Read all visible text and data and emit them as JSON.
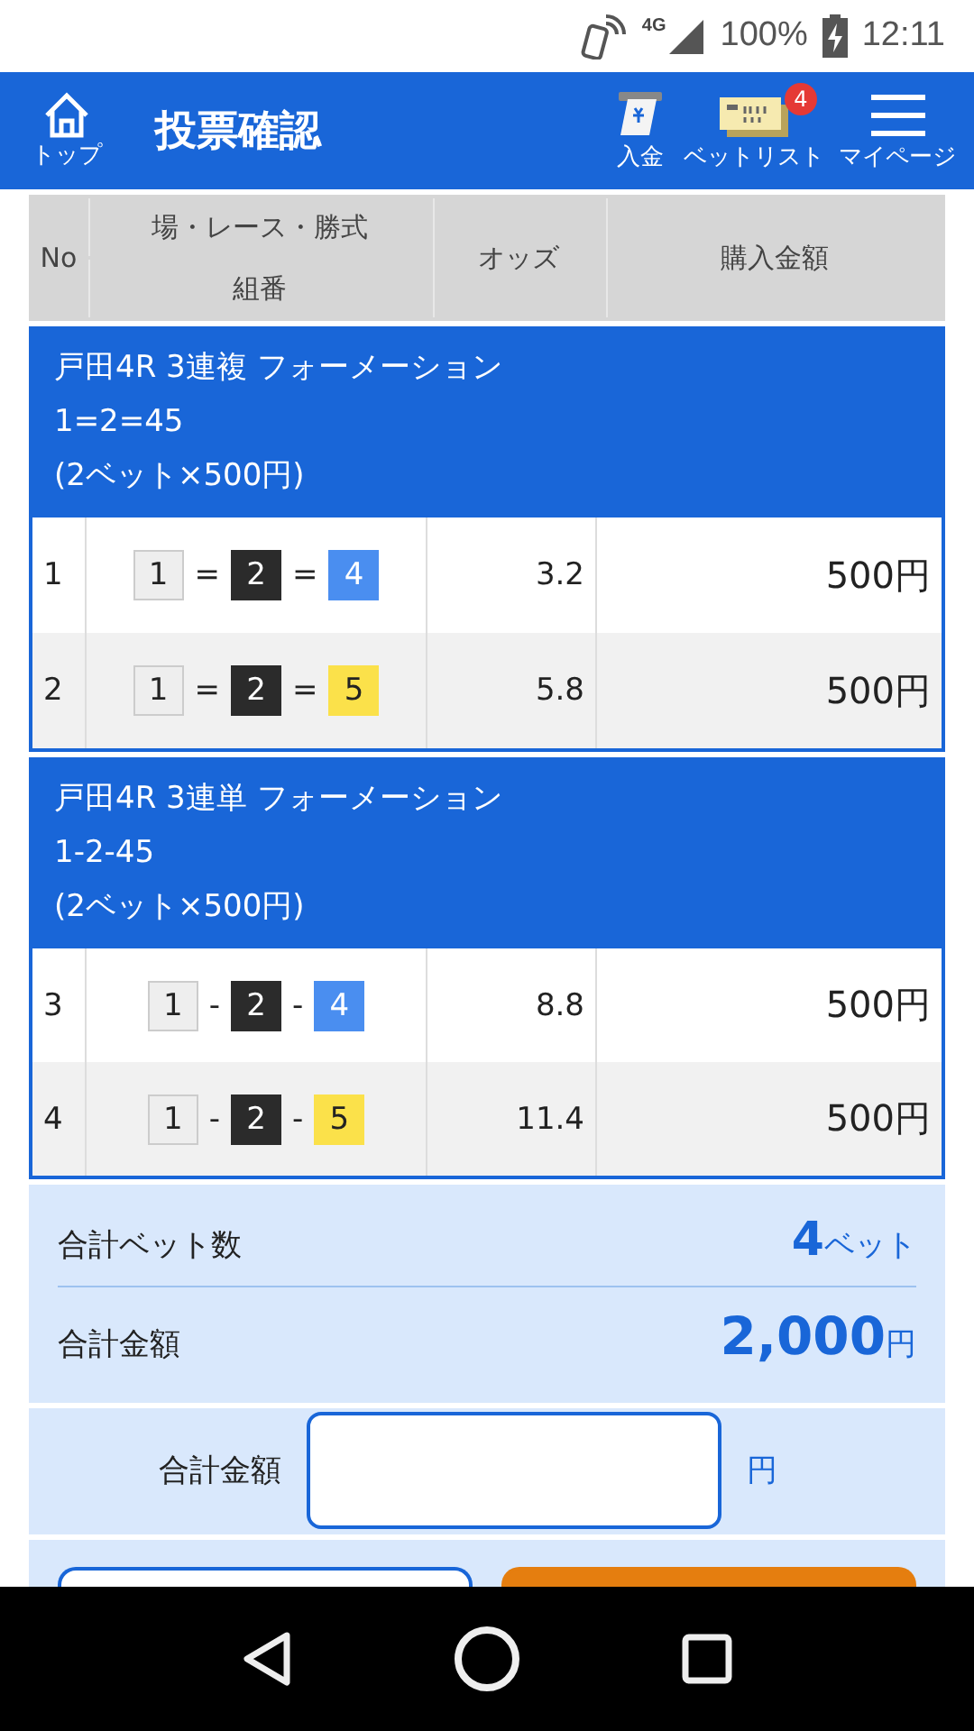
{
  "status_bar": {
    "network": "4G",
    "battery": "100%",
    "time": "12:11"
  },
  "header": {
    "home_label": "トップ",
    "title": "投票確認",
    "actions": [
      {
        "label": "入金",
        "kind": "deposit"
      },
      {
        "label": "ベットリスト",
        "kind": "betlist",
        "badge": "4"
      },
      {
        "label": "マイページ",
        "kind": "menu"
      }
    ]
  },
  "table": {
    "columns": {
      "no": "No",
      "race_top": "場・レース・勝式",
      "race_bottom": "組番",
      "odds": "オッズ",
      "amount": "購入金額"
    },
    "groups": [
      {
        "title": "戸田4R 3連複 フォーメーション",
        "combination": "1=2=45",
        "detail": "(2ベット×500円)",
        "rows": [
          {
            "no": "1",
            "combo": [
              {
                "kind": "boat",
                "label": "1",
                "color": "#eeeeee"
              },
              {
                "kind": "sep",
                "label": "="
              },
              {
                "kind": "boat",
                "label": "2",
                "color": "#2b2b2b"
              },
              {
                "kind": "sep",
                "label": "="
              },
              {
                "kind": "boat",
                "label": "4",
                "color": "#4a8ef0"
              }
            ],
            "odds": "3.2",
            "amount": "500円"
          },
          {
            "no": "2",
            "combo": [
              {
                "kind": "boat",
                "label": "1",
                "color": "#eeeeee"
              },
              {
                "kind": "sep",
                "label": "="
              },
              {
                "kind": "boat",
                "label": "2",
                "color": "#2b2b2b"
              },
              {
                "kind": "sep",
                "label": "="
              },
              {
                "kind": "boat",
                "label": "5",
                "color": "#fbe14a"
              }
            ],
            "odds": "5.8",
            "amount": "500円"
          }
        ]
      },
      {
        "title": "戸田4R 3連単 フォーメーション",
        "combination": "1-2-45",
        "detail": "(2ベット×500円)",
        "rows": [
          {
            "no": "3",
            "combo": [
              {
                "kind": "boat",
                "label": "1",
                "color": "#eeeeee"
              },
              {
                "kind": "sep",
                "label": "-"
              },
              {
                "kind": "boat",
                "label": "2",
                "color": "#2b2b2b"
              },
              {
                "kind": "sep",
                "label": "-"
              },
              {
                "kind": "boat",
                "label": "4",
                "color": "#4a8ef0"
              }
            ],
            "odds": "8.8",
            "amount": "500円"
          },
          {
            "no": "4",
            "combo": [
              {
                "kind": "boat",
                "label": "1",
                "color": "#eeeeee"
              },
              {
                "kind": "sep",
                "label": "-"
              },
              {
                "kind": "boat",
                "label": "2",
                "color": "#2b2b2b"
              },
              {
                "kind": "sep",
                "label": "-"
              },
              {
                "kind": "boat",
                "label": "5",
                "color": "#fbe14a"
              }
            ],
            "odds": "11.4",
            "amount": "500円"
          }
        ]
      }
    ]
  },
  "summary": [
    {
      "label": "合計ベット数",
      "value": "4",
      "unit": "ベット"
    },
    {
      "label": "合計金額",
      "value": "2,000",
      "unit": "円"
    }
  ],
  "amount_input": {
    "label": "合計金額",
    "unit": "円"
  }
}
